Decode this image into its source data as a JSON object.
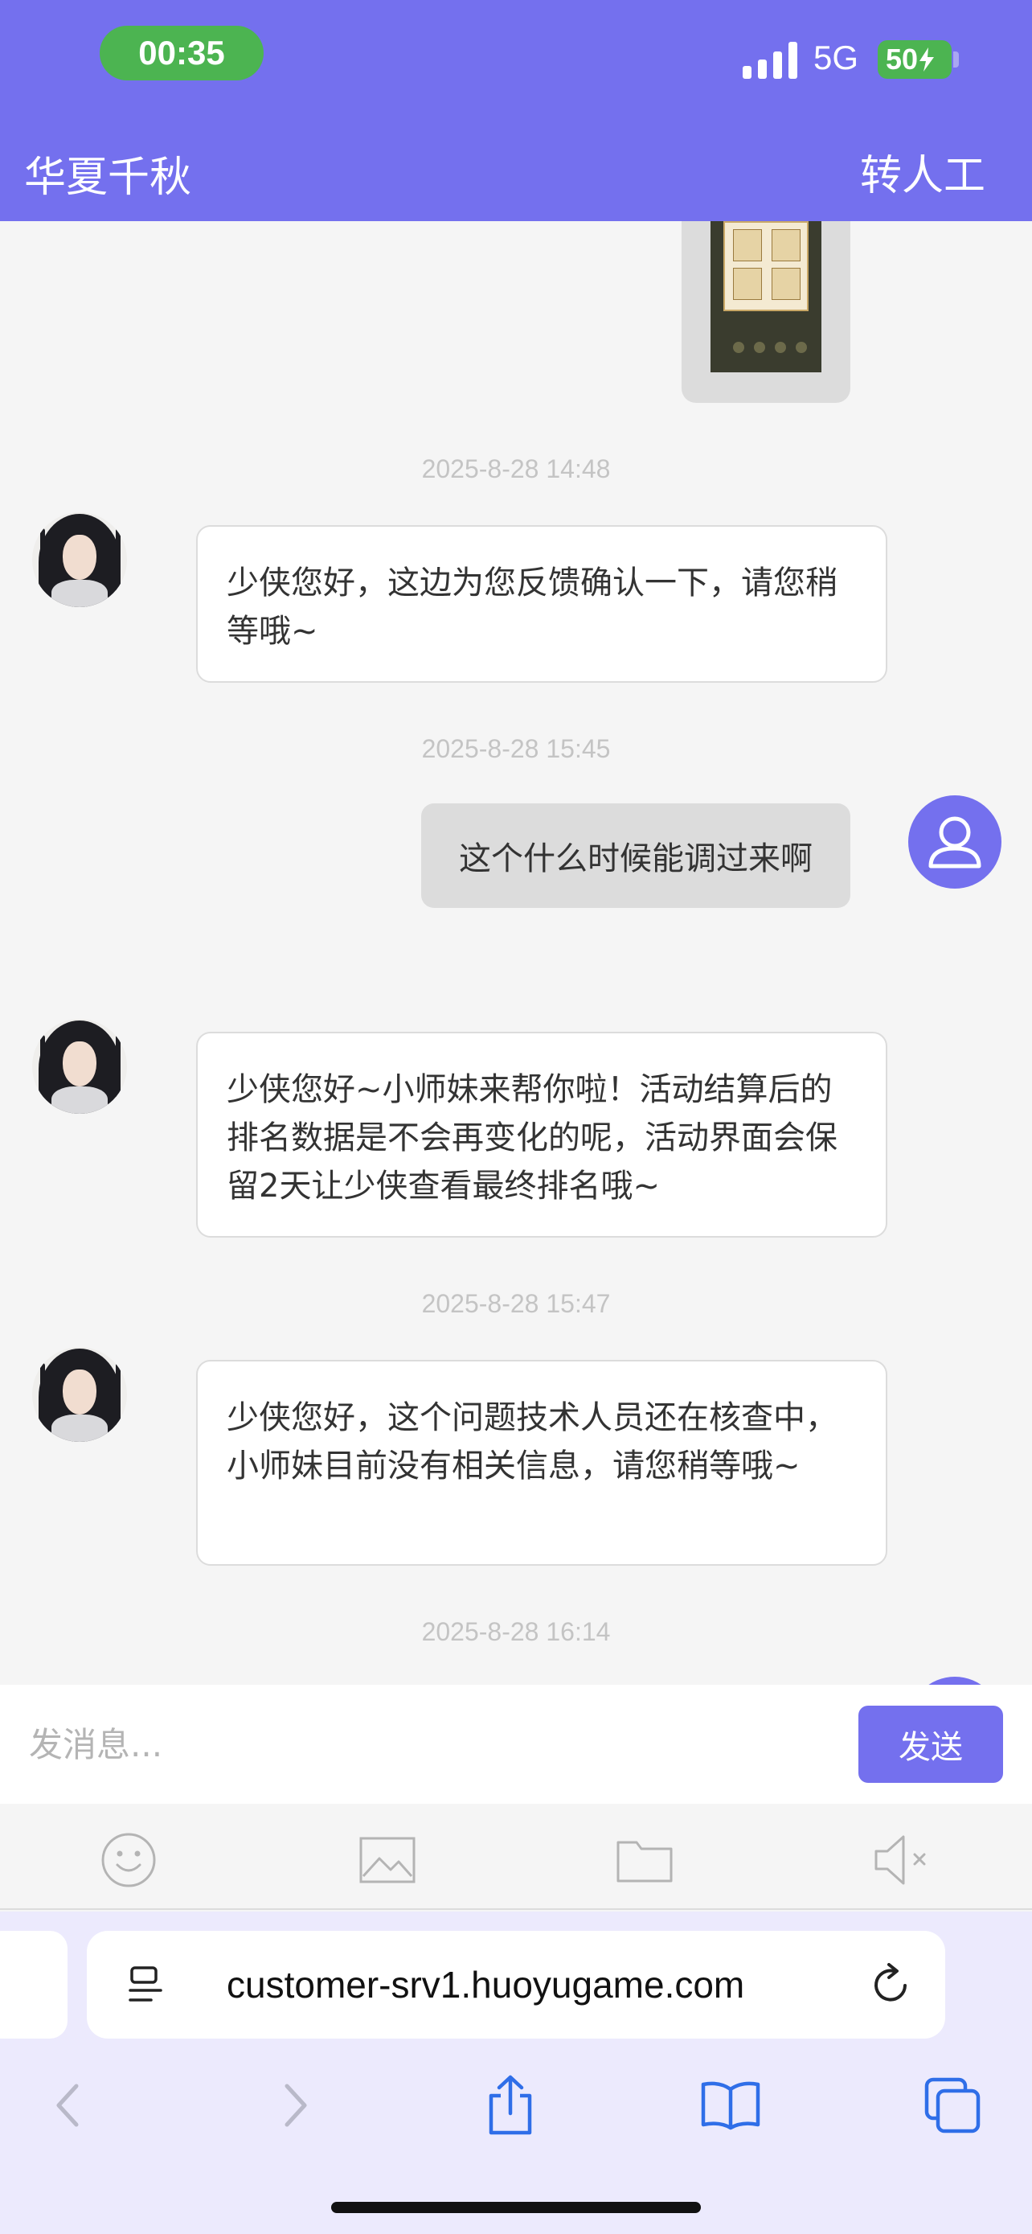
{
  "status_bar": {
    "time": "00:35",
    "network": "5G",
    "battery": "50"
  },
  "header": {
    "title": "华夏千秋",
    "human_agent_label": "转人工"
  },
  "messages": [
    {
      "timestamp": "2025-8-28 14:48",
      "text": "少侠您好，这边为您反馈确认一下，请您稍等哦~"
    },
    {
      "timestamp": "2025-8-28 15:45",
      "text": "这个什么时候能调过来啊"
    },
    {
      "text": "少侠您好~小师妹来帮你啦！活动结算后的排名数据是不会再变化的呢，活动界面会保留2天让少侠查看最终排名哦~"
    },
    {
      "timestamp": "2025-8-28 15:47",
      "text": "少侠您好，这个问题技术人员还在核查中，小师妹目前没有相关信息，请您稍等哦~"
    },
    {
      "timestamp": "2025-8-28 16:14"
    }
  ],
  "composer": {
    "placeholder": "发消息...",
    "send_label": "发送"
  },
  "toolbar_icons": [
    "emoji-icon",
    "image-icon",
    "folder-icon",
    "mute-icon"
  ],
  "browser": {
    "url": "customer-srv1.huoyugame.com"
  },
  "colors": {
    "brand": "#7470ee",
    "status_green": "#4cb451",
    "page_bg": "#f5f5f5"
  }
}
